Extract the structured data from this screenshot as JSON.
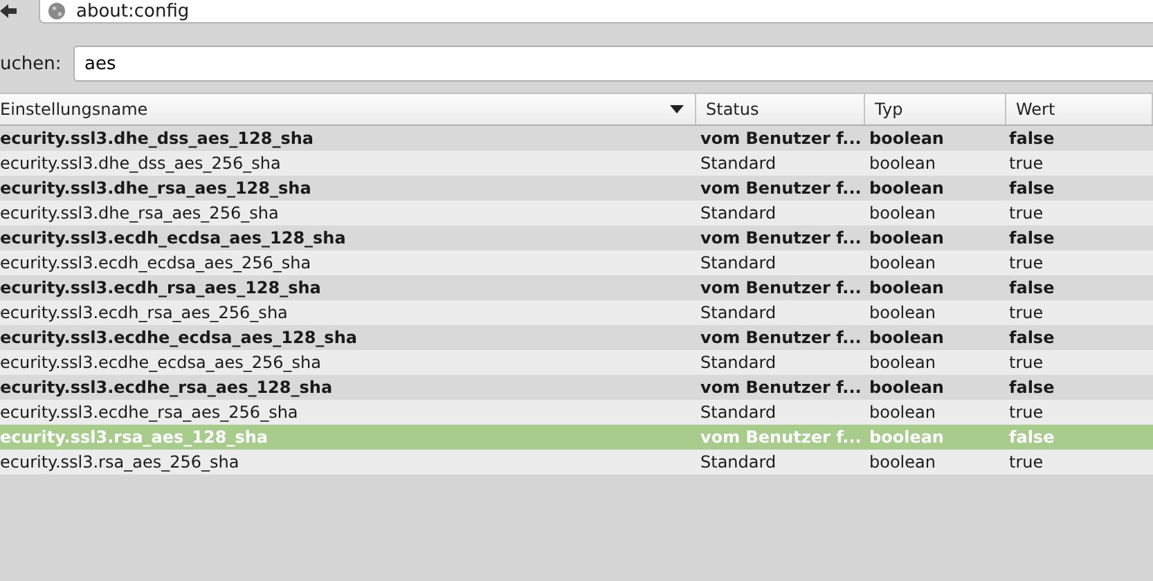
{
  "address_bar": {
    "url": "about:config"
  },
  "search": {
    "label": "uchen:",
    "value": "aes"
  },
  "table": {
    "columns": [
      {
        "label": "Einstellungsname",
        "sorted": true
      },
      {
        "label": "Status",
        "sorted": false
      },
      {
        "label": "Typ",
        "sorted": false
      },
      {
        "label": "Wert",
        "sorted": false
      }
    ],
    "rows": [
      {
        "name": "ecurity.ssl3.dhe_dss_aes_128_sha",
        "status": "vom Benutzer f...",
        "type": "boolean",
        "value": "false",
        "modified": true,
        "selected": false
      },
      {
        "name": "ecurity.ssl3.dhe_dss_aes_256_sha",
        "status": "Standard",
        "type": "boolean",
        "value": "true",
        "modified": false,
        "selected": false
      },
      {
        "name": "ecurity.ssl3.dhe_rsa_aes_128_sha",
        "status": "vom Benutzer f...",
        "type": "boolean",
        "value": "false",
        "modified": true,
        "selected": false
      },
      {
        "name": "ecurity.ssl3.dhe_rsa_aes_256_sha",
        "status": "Standard",
        "type": "boolean",
        "value": "true",
        "modified": false,
        "selected": false
      },
      {
        "name": "ecurity.ssl3.ecdh_ecdsa_aes_128_sha",
        "status": "vom Benutzer f...",
        "type": "boolean",
        "value": "false",
        "modified": true,
        "selected": false
      },
      {
        "name": "ecurity.ssl3.ecdh_ecdsa_aes_256_sha",
        "status": "Standard",
        "type": "boolean",
        "value": "true",
        "modified": false,
        "selected": false
      },
      {
        "name": "ecurity.ssl3.ecdh_rsa_aes_128_sha",
        "status": "vom Benutzer f...",
        "type": "boolean",
        "value": "false",
        "modified": true,
        "selected": false
      },
      {
        "name": "ecurity.ssl3.ecdh_rsa_aes_256_sha",
        "status": "Standard",
        "type": "boolean",
        "value": "true",
        "modified": false,
        "selected": false
      },
      {
        "name": "ecurity.ssl3.ecdhe_ecdsa_aes_128_sha",
        "status": "vom Benutzer f...",
        "type": "boolean",
        "value": "false",
        "modified": true,
        "selected": false
      },
      {
        "name": "ecurity.ssl3.ecdhe_ecdsa_aes_256_sha",
        "status": "Standard",
        "type": "boolean",
        "value": "true",
        "modified": false,
        "selected": false
      },
      {
        "name": "ecurity.ssl3.ecdhe_rsa_aes_128_sha",
        "status": "vom Benutzer f...",
        "type": "boolean",
        "value": "false",
        "modified": true,
        "selected": false
      },
      {
        "name": "ecurity.ssl3.ecdhe_rsa_aes_256_sha",
        "status": "Standard",
        "type": "boolean",
        "value": "true",
        "modified": false,
        "selected": false
      },
      {
        "name": "ecurity.ssl3.rsa_aes_128_sha",
        "status": "vom Benutzer f...",
        "type": "boolean",
        "value": "false",
        "modified": true,
        "selected": true
      },
      {
        "name": "ecurity.ssl3.rsa_aes_256_sha",
        "status": "Standard",
        "type": "boolean",
        "value": "true",
        "modified": false,
        "selected": false
      }
    ]
  }
}
